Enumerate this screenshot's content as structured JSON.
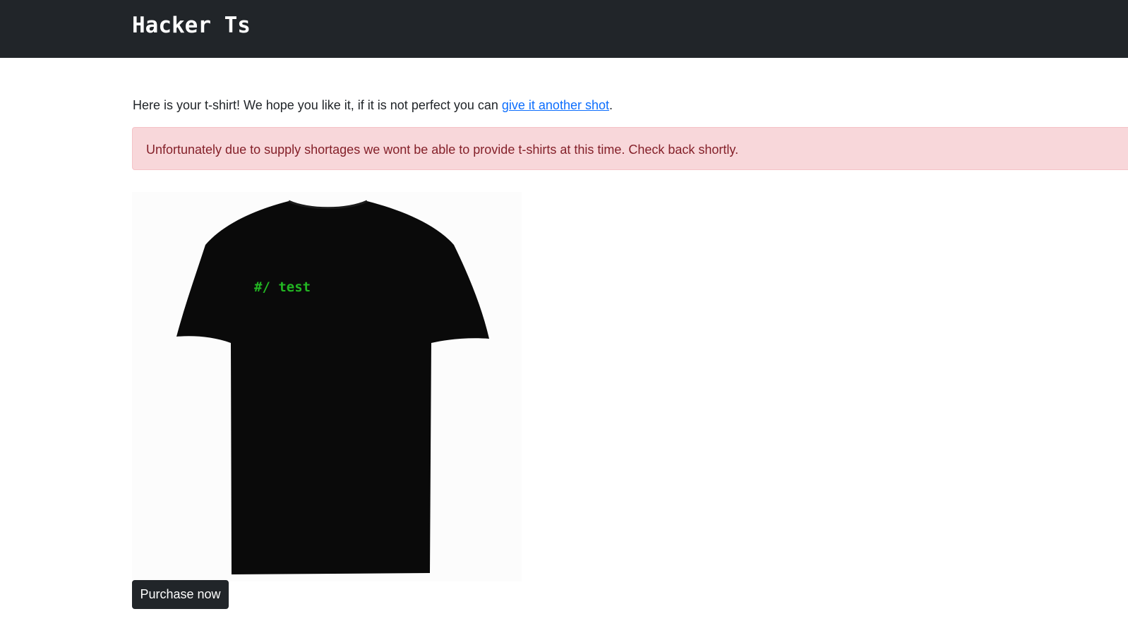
{
  "navbar": {
    "brand": "Hacker Ts"
  },
  "main": {
    "intro_text": "Here is your t-shirt! We hope you like it, if it is not perfect you can ",
    "intro_link": "give it another shot",
    "intro_end": ".",
    "alert_text": "Unfortunately due to supply shortages we wont be able to provide t-shirts at this time. Check back shortly.",
    "shirt_print": "#/ test",
    "purchase_label": "Purchase now"
  },
  "colors": {
    "navbar_bg": "#212529",
    "link": "#0d6efd",
    "alert_bg": "#f8d7da",
    "alert_text": "#842029",
    "shirt": "#0a0a0a",
    "print": "#22b522"
  }
}
